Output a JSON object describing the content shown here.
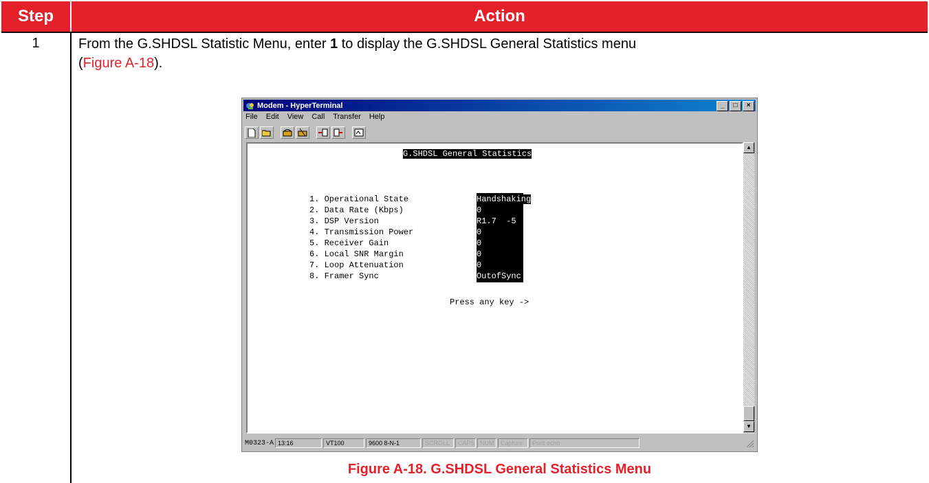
{
  "table": {
    "header_step": "Step",
    "header_action": "Action",
    "step_number": "1",
    "instruction_pre": "From the G.SHDSL Statistic Menu, enter ",
    "instruction_key": "1",
    "instruction_post": " to display the G.SHDSL General Statistics menu",
    "instruction_open": "(",
    "instruction_figure_ref": "Figure A-18",
    "instruction_close": ")."
  },
  "window": {
    "title": "Modem - HyperTerminal",
    "menu": [
      "File",
      "Edit",
      "View",
      "Call",
      "Transfer",
      "Help"
    ],
    "toolbar_icons": [
      "new-icon",
      "open-icon",
      "connect-icon",
      "disconnect-icon",
      "send-icon",
      "receive-icon",
      "properties-icon"
    ],
    "terminal": {
      "screen_title": "G.SHDSL General Statistics",
      "items": [
        {
          "label": "1. Operational State",
          "value": "Handshaking"
        },
        {
          "label": "2. Data Rate (Kbps)",
          "value": "0"
        },
        {
          "label": "3. DSP Version",
          "value": "R1.7  -5"
        },
        {
          "label": "4. Transmission Power",
          "value": "0"
        },
        {
          "label": "5. Receiver Gain",
          "value": "0"
        },
        {
          "label": "6. Local SNR Margin",
          "value": "0"
        },
        {
          "label": "7. Loop Attenuation",
          "value": "0"
        },
        {
          "label": "8. Framer Sync",
          "value": "OutofSync"
        }
      ],
      "prompt": "Press any key ->"
    },
    "status": {
      "time": "13:16",
      "emulation": "VT100",
      "settings": "9600 8-N-1",
      "scroll": "SCROLL",
      "caps": "CAPS",
      "num": "NUM",
      "capture": "Capture",
      "print_echo": "Print echo"
    }
  },
  "figure_code": "M0323-A",
  "caption": "Figure A-18. G.SHDSL General Statistics Menu"
}
